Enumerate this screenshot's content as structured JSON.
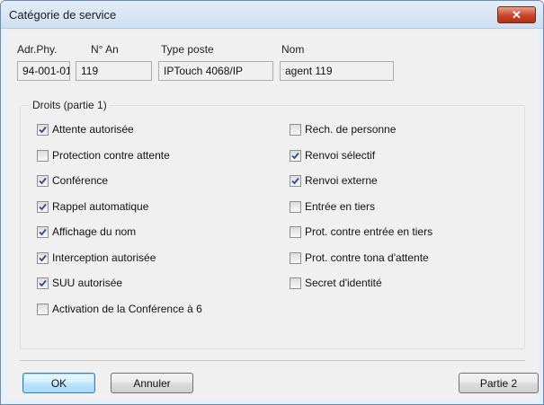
{
  "window": {
    "title": "Catégorie de service",
    "close_glyph": "✕"
  },
  "header": {
    "labels": {
      "adr_phy": "Adr.Phy.",
      "n_an": "N° An",
      "type_poste": "Type poste",
      "nom": "Nom"
    },
    "values": {
      "adr_phy": "94-001-01",
      "n_an": "119",
      "type_poste": "IPTouch 4068/IP",
      "nom": "agent 119"
    }
  },
  "group": {
    "title": "Droits (partie 1)",
    "left": [
      {
        "label": "Attente autorisée",
        "checked": true
      },
      {
        "label": "Protection contre attente",
        "checked": false
      },
      {
        "label": "Conférence",
        "checked": true
      },
      {
        "label": "Rappel automatique",
        "checked": true
      },
      {
        "label": "Affichage du nom",
        "checked": true
      },
      {
        "label": "Interception autorisée",
        "checked": true
      },
      {
        "label": "SUU autorisée",
        "checked": true
      },
      {
        "label": "Activation de la Conférence à 6",
        "checked": false
      }
    ],
    "right": [
      {
        "label": "Rech. de personne",
        "checked": false
      },
      {
        "label": "Renvoi sélectif",
        "checked": true
      },
      {
        "label": "Renvoi externe",
        "checked": true
      },
      {
        "label": "Entrée en tiers",
        "checked": false
      },
      {
        "label": "Prot. contre entrée en tiers",
        "checked": false
      },
      {
        "label": "Prot. contre tona d'attente",
        "checked": false
      },
      {
        "label": "Secret d'identité",
        "checked": false
      }
    ]
  },
  "buttons": {
    "ok": "OK",
    "cancel": "Annuler",
    "part2": "Partie 2"
  }
}
